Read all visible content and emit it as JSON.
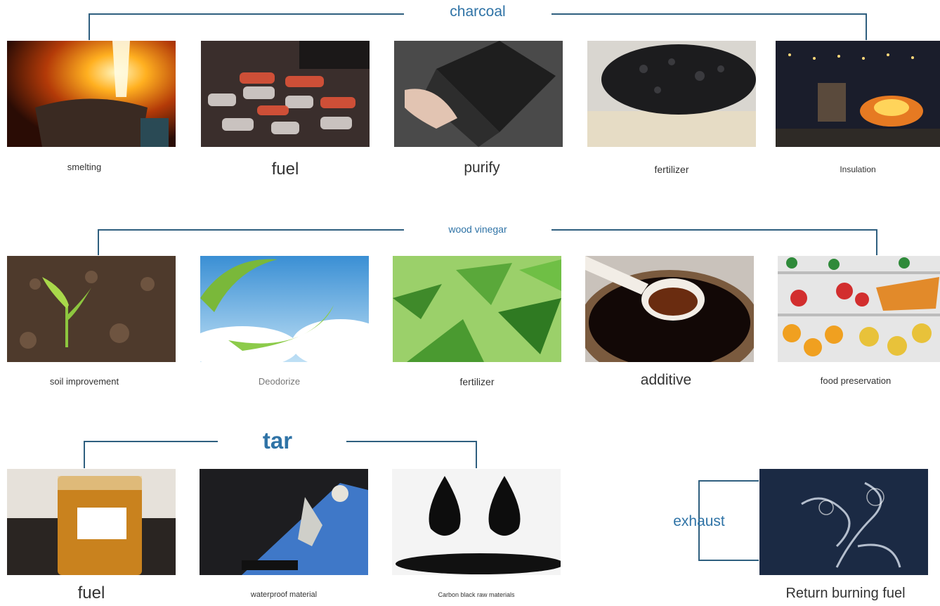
{
  "sections": {
    "charcoal": {
      "title": "charcoal",
      "items": [
        "smelting",
        "fuel",
        "purify",
        "fertilizer",
        "Insulation"
      ]
    },
    "wood_vinegar": {
      "title": "wood vinegar",
      "items": [
        "soil improvement",
        "Deodorize",
        "fertilizer",
        "additive",
        "food preservation"
      ]
    },
    "tar": {
      "title": "tar",
      "items": [
        "fuel",
        "waterproof material",
        "Carbon black raw materials"
      ]
    },
    "exhaust": {
      "title": "exhaust",
      "items": [
        "Return burning fuel"
      ]
    }
  },
  "colors": {
    "heading": "#2f73a6",
    "connector": "#2f5f7f",
    "caption": "#333333"
  }
}
